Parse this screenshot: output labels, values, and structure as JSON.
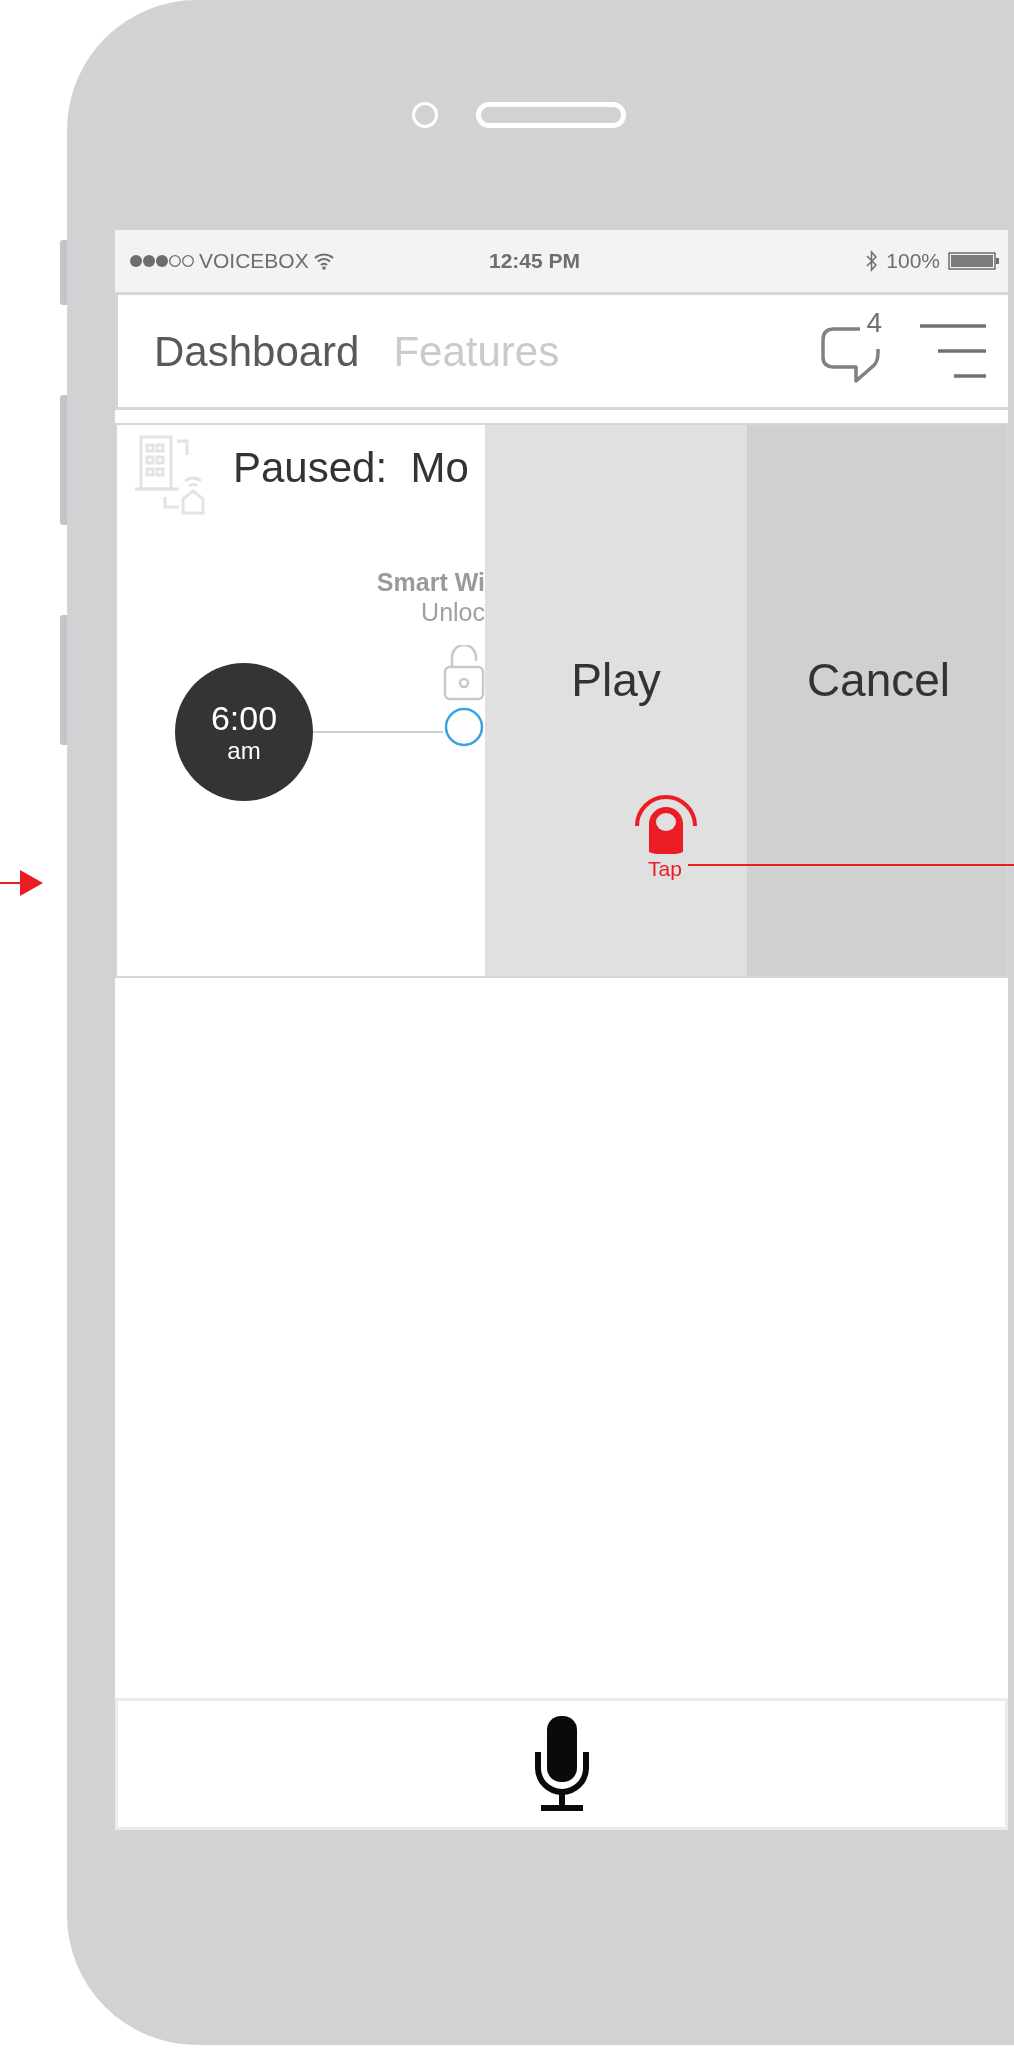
{
  "status_bar": {
    "carrier": "VOICEBOX",
    "time": "12:45 PM",
    "battery": "100%"
  },
  "tabs": [
    {
      "label": "Dashboard",
      "selected": true
    },
    {
      "label": "Features",
      "selected": false
    }
  ],
  "notifications": {
    "count": "4"
  },
  "routine": {
    "status": "Paused:",
    "name": "Mo",
    "step_title": "Smart Wi",
    "step_action": "Unloc",
    "time": "6:00",
    "period": "am"
  },
  "actions": [
    {
      "label": "Play",
      "kind": "play"
    },
    {
      "label": "Cancel",
      "kind": "cancel"
    }
  ],
  "annotation": {
    "label": "Tap"
  }
}
